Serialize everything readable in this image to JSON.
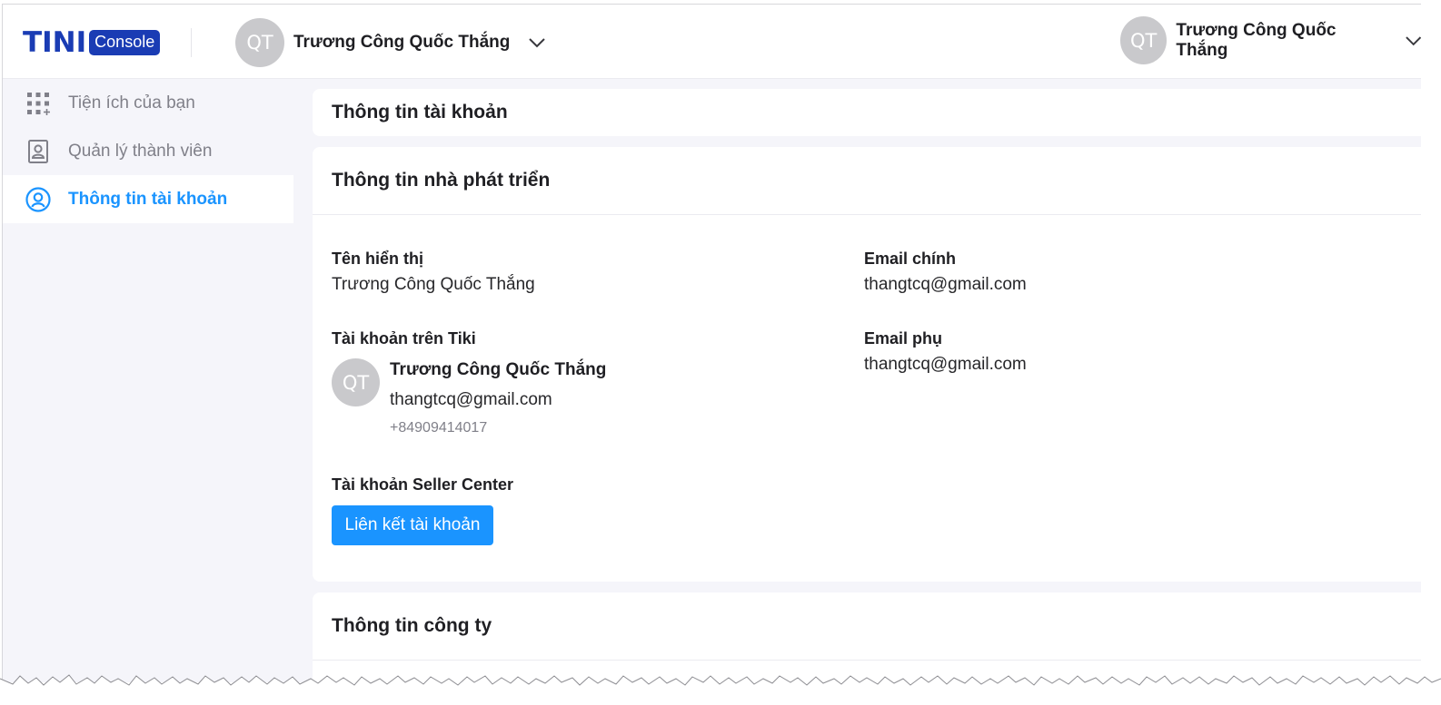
{
  "header": {
    "logo_tini": "TINI",
    "logo_console": "Console",
    "org": {
      "avatar_initials": "QT",
      "name": "Trương Công Quốc Thắng"
    },
    "user": {
      "avatar_initials": "QT",
      "name": "Trương Công Quốc Thắng"
    }
  },
  "sidebar": {
    "items": [
      {
        "label": "Tiện ích của bạn",
        "icon": "grid-apps-icon",
        "active": false
      },
      {
        "label": "Quản lý thành viên",
        "icon": "member-badge-icon",
        "active": false
      },
      {
        "label": "Thông tin tài khoản",
        "icon": "account-circle-icon",
        "active": true
      }
    ]
  },
  "main": {
    "page_title": "Thông tin tài khoản",
    "developer": {
      "title": "Thông tin nhà phát triển",
      "display_name_label": "Tên hiển thị",
      "display_name_value": "Trương Công Quốc Thắng",
      "primary_email_label": "Email chính",
      "primary_email_value": "thangtcq@gmail.com",
      "tiki_account_label": "Tài khoản trên Tiki",
      "tiki_account": {
        "avatar_initials": "QT",
        "name": "Trương Công Quốc Thắng",
        "email": "thangtcq@gmail.com",
        "phone": "+84909414017"
      },
      "secondary_email_label": "Email phụ",
      "secondary_email_value": "thangtcq@gmail.com",
      "seller_center_label": "Tài khoản Seller Center",
      "link_button_label": "Liên kết tài khoản"
    },
    "company": {
      "title": "Thông tin công ty"
    }
  },
  "colors": {
    "brand": "#1a3cb4",
    "accent": "#1a94ff",
    "page_bg": "#f5f5fa",
    "avatar_bg": "#c9c9cc"
  }
}
